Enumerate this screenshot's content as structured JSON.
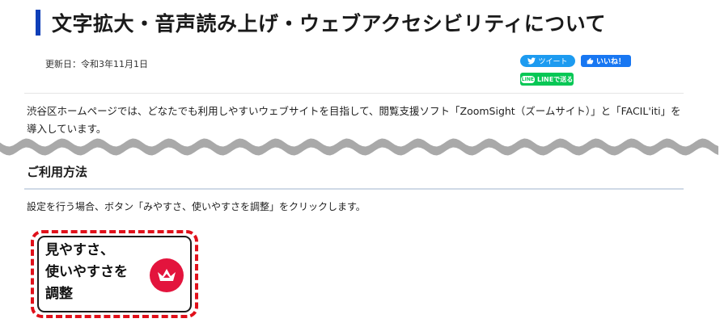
{
  "page": {
    "title": "文字拡大・音声読み上げ・ウェブアクセシビリティについて",
    "updated": "更新日：令和3年11月1日"
  },
  "social": {
    "tweet": "ツイート",
    "like": "いいね！",
    "line_badge": "LINE",
    "line": "LINEで送る"
  },
  "intro": {
    "text": "渋谷区ホームページでは、どなたでも利用しやすいウェブサイトを目指して、閲覧支援ソフト「ZoomSight（ズームサイト）」と「FACIL'iti」を導入しています。"
  },
  "usage": {
    "heading": "ご利用方法",
    "instruction": "設定を行う場合、ボタン「みやすさ、使いやすさを調整」をクリックします。",
    "button_lines": [
      "見やすさ、",
      "使いやすさを",
      "調整"
    ]
  },
  "colors": {
    "accent": "#0f3fb8",
    "highlight": "#e0101a",
    "crown": "#e3143d",
    "twitter": "#1d9bf0",
    "facebook": "#1877f2",
    "line": "#06c755"
  }
}
